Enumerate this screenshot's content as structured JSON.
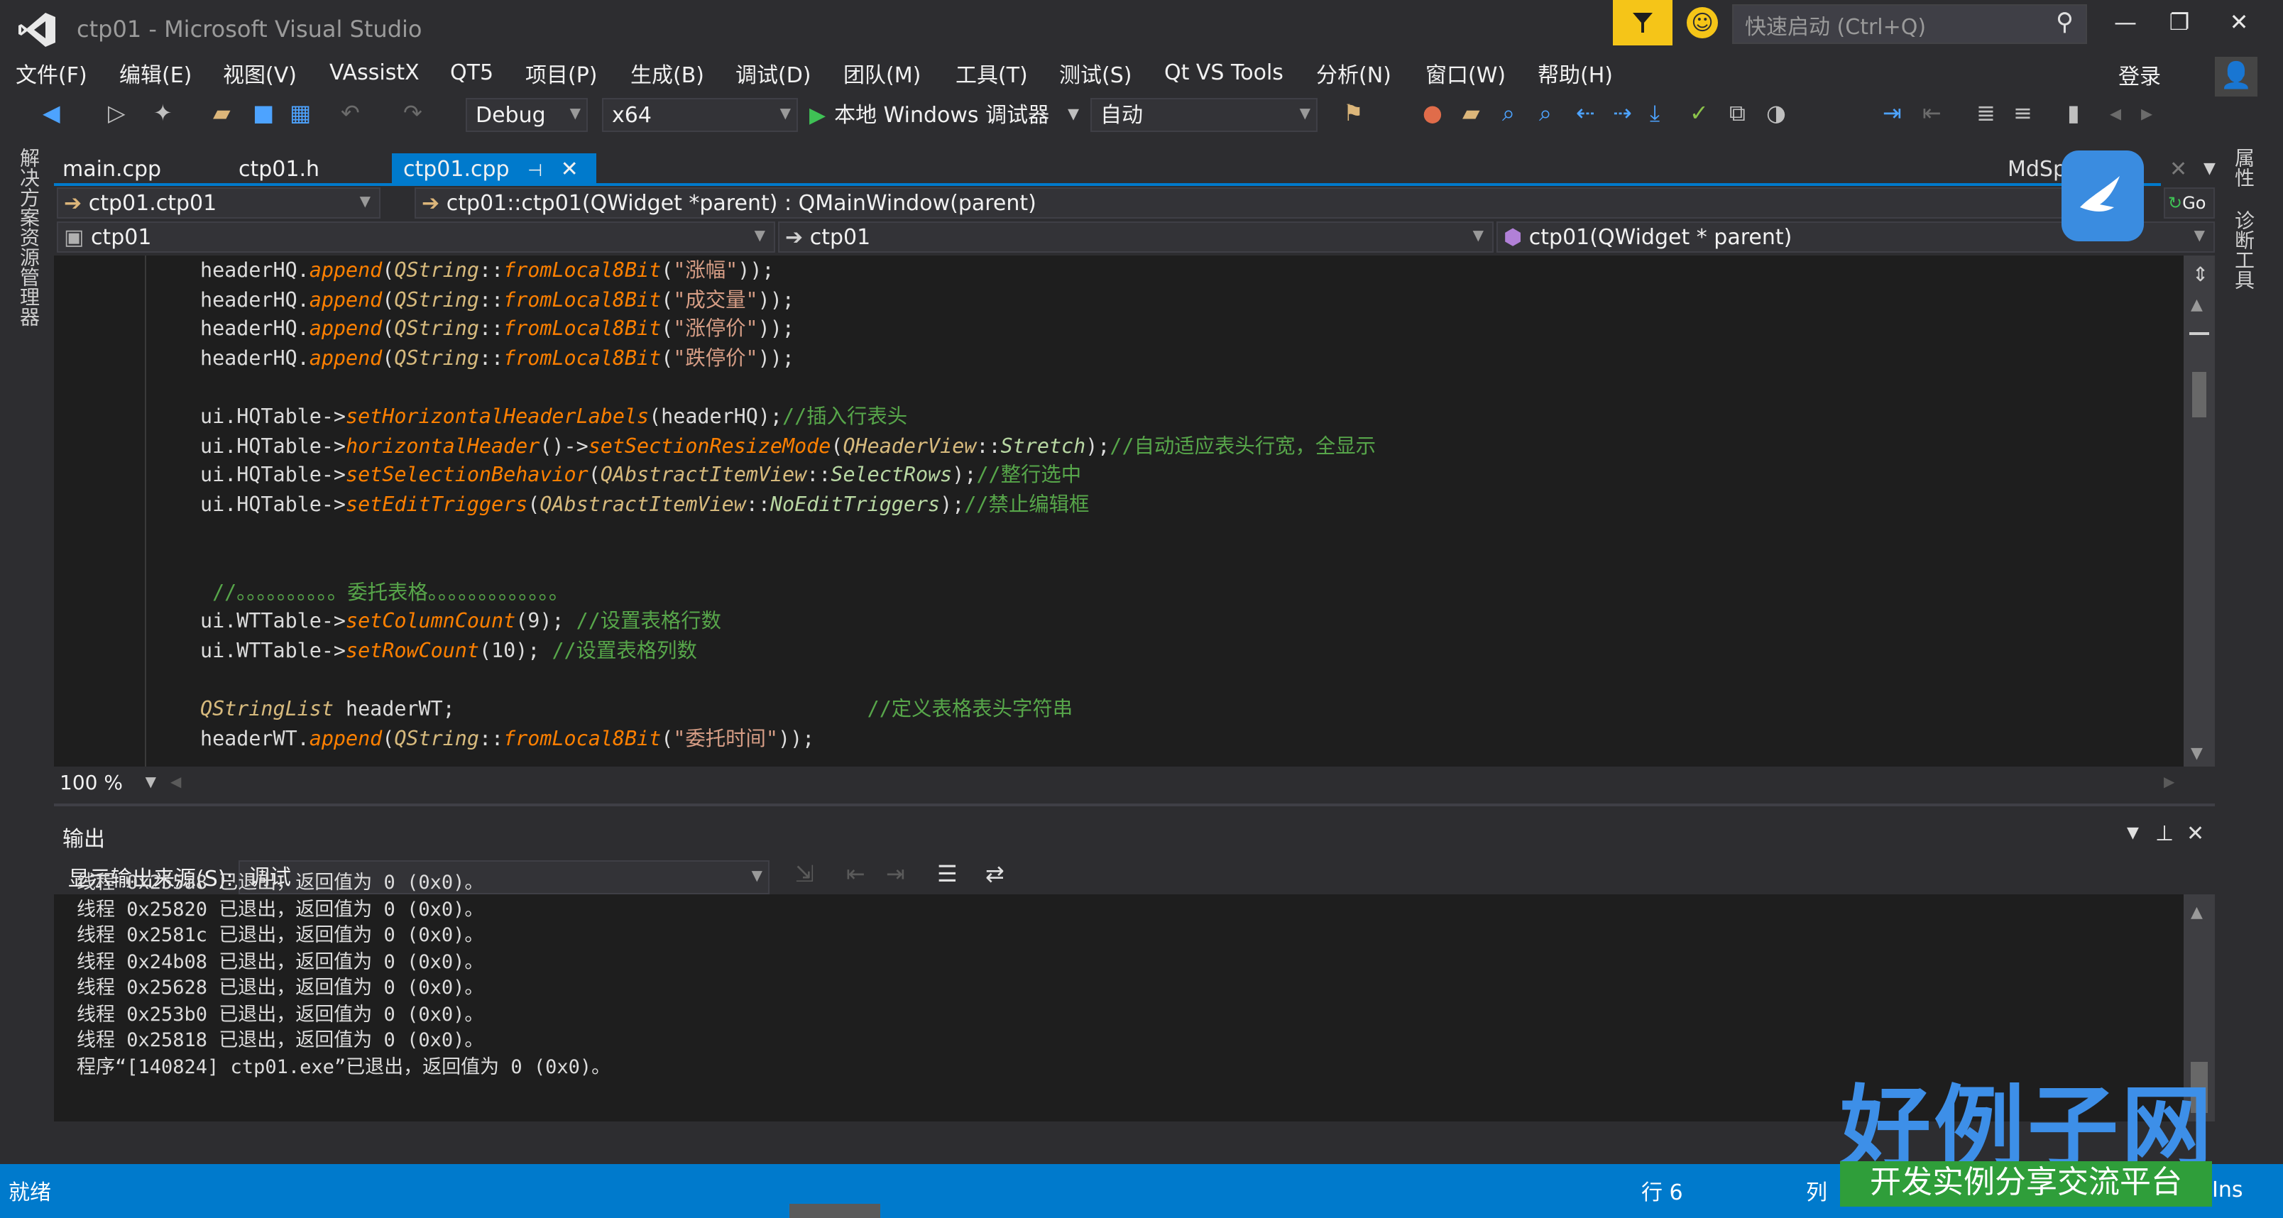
{
  "window": {
    "title": "ctp01 - Microsoft Visual Studio",
    "minimize": "—",
    "restore": "❐",
    "close": "✕"
  },
  "quick_launch": {
    "placeholder": "快速启动 (Ctrl+Q)"
  },
  "menu": [
    "文件(F)",
    "编辑(E)",
    "视图(V)",
    "VAssistX",
    "QT5",
    "项目(P)",
    "生成(B)",
    "调试(D)",
    "团队(M)",
    "工具(T)",
    "测试(S)",
    "Qt VS Tools",
    "分析(N)",
    "窗口(W)",
    "帮助(H)"
  ],
  "login": "登录",
  "toolbar": {
    "config": "Debug",
    "platform": "x64",
    "run_label": "本地 Windows 调试器",
    "auto": "自动"
  },
  "side_tabs": {
    "left": "解决方案资源管理器",
    "right1": "属性",
    "right2": "诊断工具"
  },
  "doc_tabs": [
    {
      "label": "main.cpp"
    },
    {
      "label": "ctp01.h"
    },
    {
      "label": "ctp01.cpp"
    }
  ],
  "doc_tab_right": "MdSpi",
  "nav1": {
    "scope": "ctp01.ctp01",
    "member": "ctp01::ctp01(QWidget *parent) : QMainWindow(parent)"
  },
  "nav2": {
    "project": "ctp01",
    "class": "ctp01",
    "func": "ctp01(QWidget * parent)",
    "go": "Go"
  },
  "code_lines": [
    "headerHQ.append(QString::fromLocal8Bit(\"涨幅\"));",
    "headerHQ.append(QString::fromLocal8Bit(\"成交量\"));",
    "headerHQ.append(QString::fromLocal8Bit(\"涨停价\"));",
    "headerHQ.append(QString::fromLocal8Bit(\"跌停价\"));",
    "",
    "ui.HQTable->setHorizontalHeaderLabels(headerHQ);//插入行表头",
    "ui.HQTable->horizontalHeader()->setSectionResizeMode(QHeaderView::Stretch);//自动适应表头行宽，全显示",
    "ui.HQTable->setSelectionBehavior(QAbstractItemView::SelectRows);//整行选中",
    "ui.HQTable->setEditTriggers(QAbstractItemView::NoEditTriggers);//禁止编辑框",
    "",
    "",
    " //。。。。。。。。。。委托表格。。。。。。。。。。。。。",
    "ui.WTTable->setColumnCount(9); //设置表格行数",
    "ui.WTTable->setRowCount(10); //设置表格列数",
    "",
    "QStringList headerWT;                                  //定义表格表头字符串",
    "headerWT.append(QString::fromLocal8Bit(\"委托时间\"));"
  ],
  "zoom": "100 %",
  "output": {
    "title": "输出",
    "source_label": "显示输出来源(S):",
    "source_value": "调试",
    "lines": [
      "线程 0x255a8 已退出，返回值为 0 (0x0)。",
      "线程 0x25820 已退出，返回值为 0 (0x0)。",
      "线程 0x2581c 已退出，返回值为 0 (0x0)。",
      "线程 0x24b08 已退出，返回值为 0 (0x0)。",
      "线程 0x25628 已退出，返回值为 0 (0x0)。",
      "线程 0x253b0 已退出，返回值为 0 (0x0)。",
      "线程 0x25818 已退出，返回值为 0 (0x0)。",
      "程序“[140824] ctp01.exe”已退出，返回值为 0 (0x0)。"
    ]
  },
  "status": {
    "left": "就绪",
    "row": "行 6",
    "col": "列",
    "ins": "Ins"
  },
  "watermark": {
    "big": "好例子网",
    "small": "开发实例分享交流平台"
  }
}
